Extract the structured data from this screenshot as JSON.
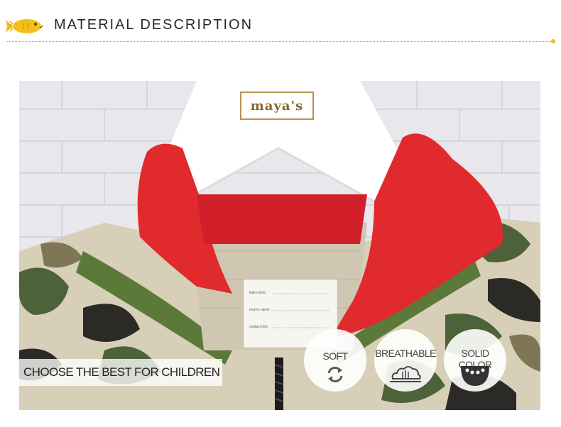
{
  "header": {
    "title": "MATERIAL DESCRIPTION",
    "accent_color": "#f2c019"
  },
  "photo": {
    "brand_tag": "maya's",
    "label_lines": [
      "kids name:",
      "mum's name:",
      "contact info:"
    ],
    "tagline": "CHOOSE THE BEST FOR CHILDREN"
  },
  "features": [
    {
      "label": "SOFT",
      "icon": "refresh-icon"
    },
    {
      "label": "BREATHABLE",
      "icon": "breathable-cloud-icon"
    },
    {
      "label": "SOLID COLOR",
      "icon": "solid-color-icon"
    }
  ]
}
